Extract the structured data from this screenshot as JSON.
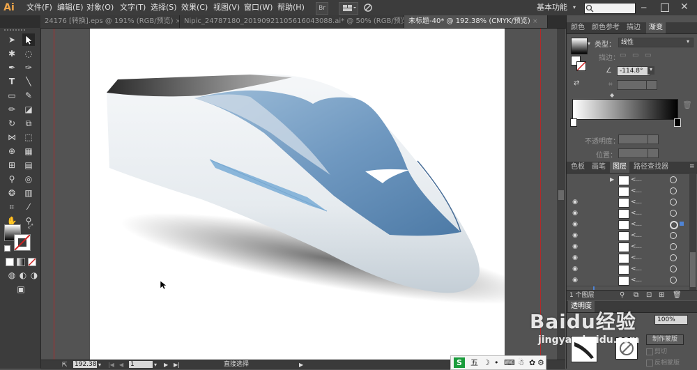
{
  "app": {
    "logo": "Ai"
  },
  "menus": [
    "文件(F)",
    "编辑(E)",
    "对象(O)",
    "文字(T)",
    "选择(S)",
    "效果(C)",
    "视图(V)",
    "窗口(W)",
    "帮助(H)"
  ],
  "menubar_buttons": {
    "br": "Br"
  },
  "workspace": {
    "label": "基本功能",
    "arrow": "▾"
  },
  "tabs": [
    {
      "label": "24176 [转换].eps @ 191% (RGB/预览)",
      "close": "×"
    },
    {
      "label": "Nipic_24787180_20190921105616043088.ai* @ 50% (RGB/预览)",
      "close": "×"
    },
    {
      "label": "未标题-40* @ 192.38% (CMYK/预览)",
      "close": "×"
    }
  ],
  "panel_top_tabs": [
    "颜色",
    "颜色参考",
    "描边",
    "渐变"
  ],
  "gradient": {
    "type_label": "类型：",
    "type_value": "线性",
    "stroke_label": "描边：",
    "angle_value": "-114.8°",
    "opacity_label": "不透明度：",
    "position_label": "位置："
  },
  "panel_bottom_tabs": [
    "色板",
    "画笔",
    "图层",
    "路径查找器"
  ],
  "layers": {
    "rows": [
      {
        "eye": "",
        "name": "<...",
        "expand": "▶"
      },
      {
        "eye": "",
        "name": "<...",
        "expand": ""
      },
      {
        "eye": "◉",
        "name": "<...",
        "expand": ""
      },
      {
        "eye": "◉",
        "name": "<...",
        "expand": ""
      },
      {
        "eye": "◉",
        "name": "<...",
        "expand": ""
      },
      {
        "eye": "◉",
        "name": "<...",
        "expand": ""
      },
      {
        "eye": "◉",
        "name": "<...",
        "expand": ""
      },
      {
        "eye": "◉",
        "name": "<...",
        "expand": ""
      },
      {
        "eye": "◉",
        "name": "<...",
        "expand": ""
      },
      {
        "eye": "◉",
        "name": "<...",
        "expand": ""
      }
    ],
    "footer": "1 个图层"
  },
  "transparency": {
    "tab": "透明度",
    "opacity_value": "100%",
    "make_mask": "制作蒙版",
    "clip": "剪切",
    "invert_mask": "反相蒙版"
  },
  "status": {
    "zoom": "192.38",
    "page": "1",
    "tool": "直接选择"
  },
  "ime": {
    "label": "五"
  },
  "watermark": {
    "main": "Baidu经验",
    "sub": "jingyan.baidu.com"
  },
  "colors": {
    "accent": "#f0a64a",
    "train_blue": "#5f8fb8",
    "guide": "#b02a2a"
  }
}
